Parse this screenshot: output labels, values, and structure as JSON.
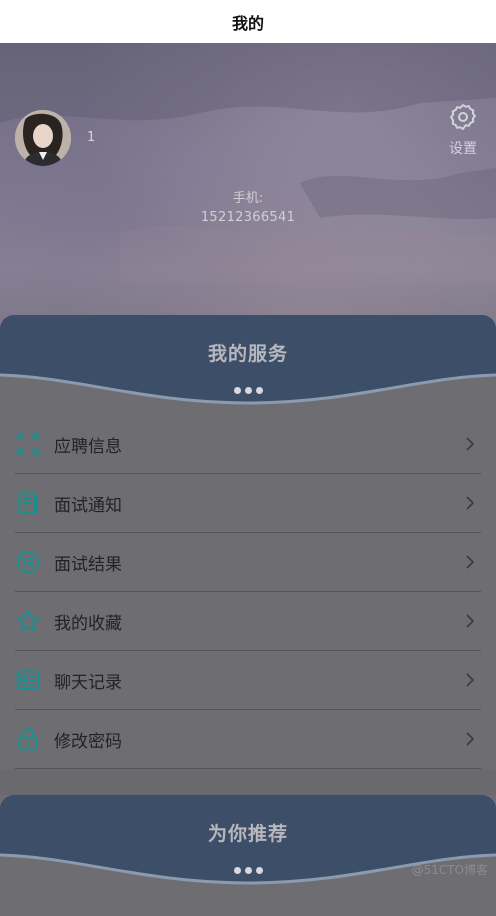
{
  "nav": {
    "title": "我的"
  },
  "profile": {
    "username": "1",
    "phone_label": "手机:",
    "phone_number": "15212366541",
    "settings_label": "设置"
  },
  "services": {
    "title": "我的服务",
    "items": [
      {
        "label": "应聘信息",
        "icon": "expand-icon"
      },
      {
        "label": "面试通知",
        "icon": "document-icon"
      },
      {
        "label": "面试结果",
        "icon": "result-icon"
      },
      {
        "label": "我的收藏",
        "icon": "star-icon"
      },
      {
        "label": "聊天记录",
        "icon": "chat-record-icon"
      },
      {
        "label": "修改密码",
        "icon": "lock-icon"
      }
    ]
  },
  "recommend": {
    "title": "为你推荐"
  },
  "watermark": "@51CTO博客",
  "colors": {
    "accent": "#1a8f8f",
    "panel_header": "#3b4f6b"
  }
}
